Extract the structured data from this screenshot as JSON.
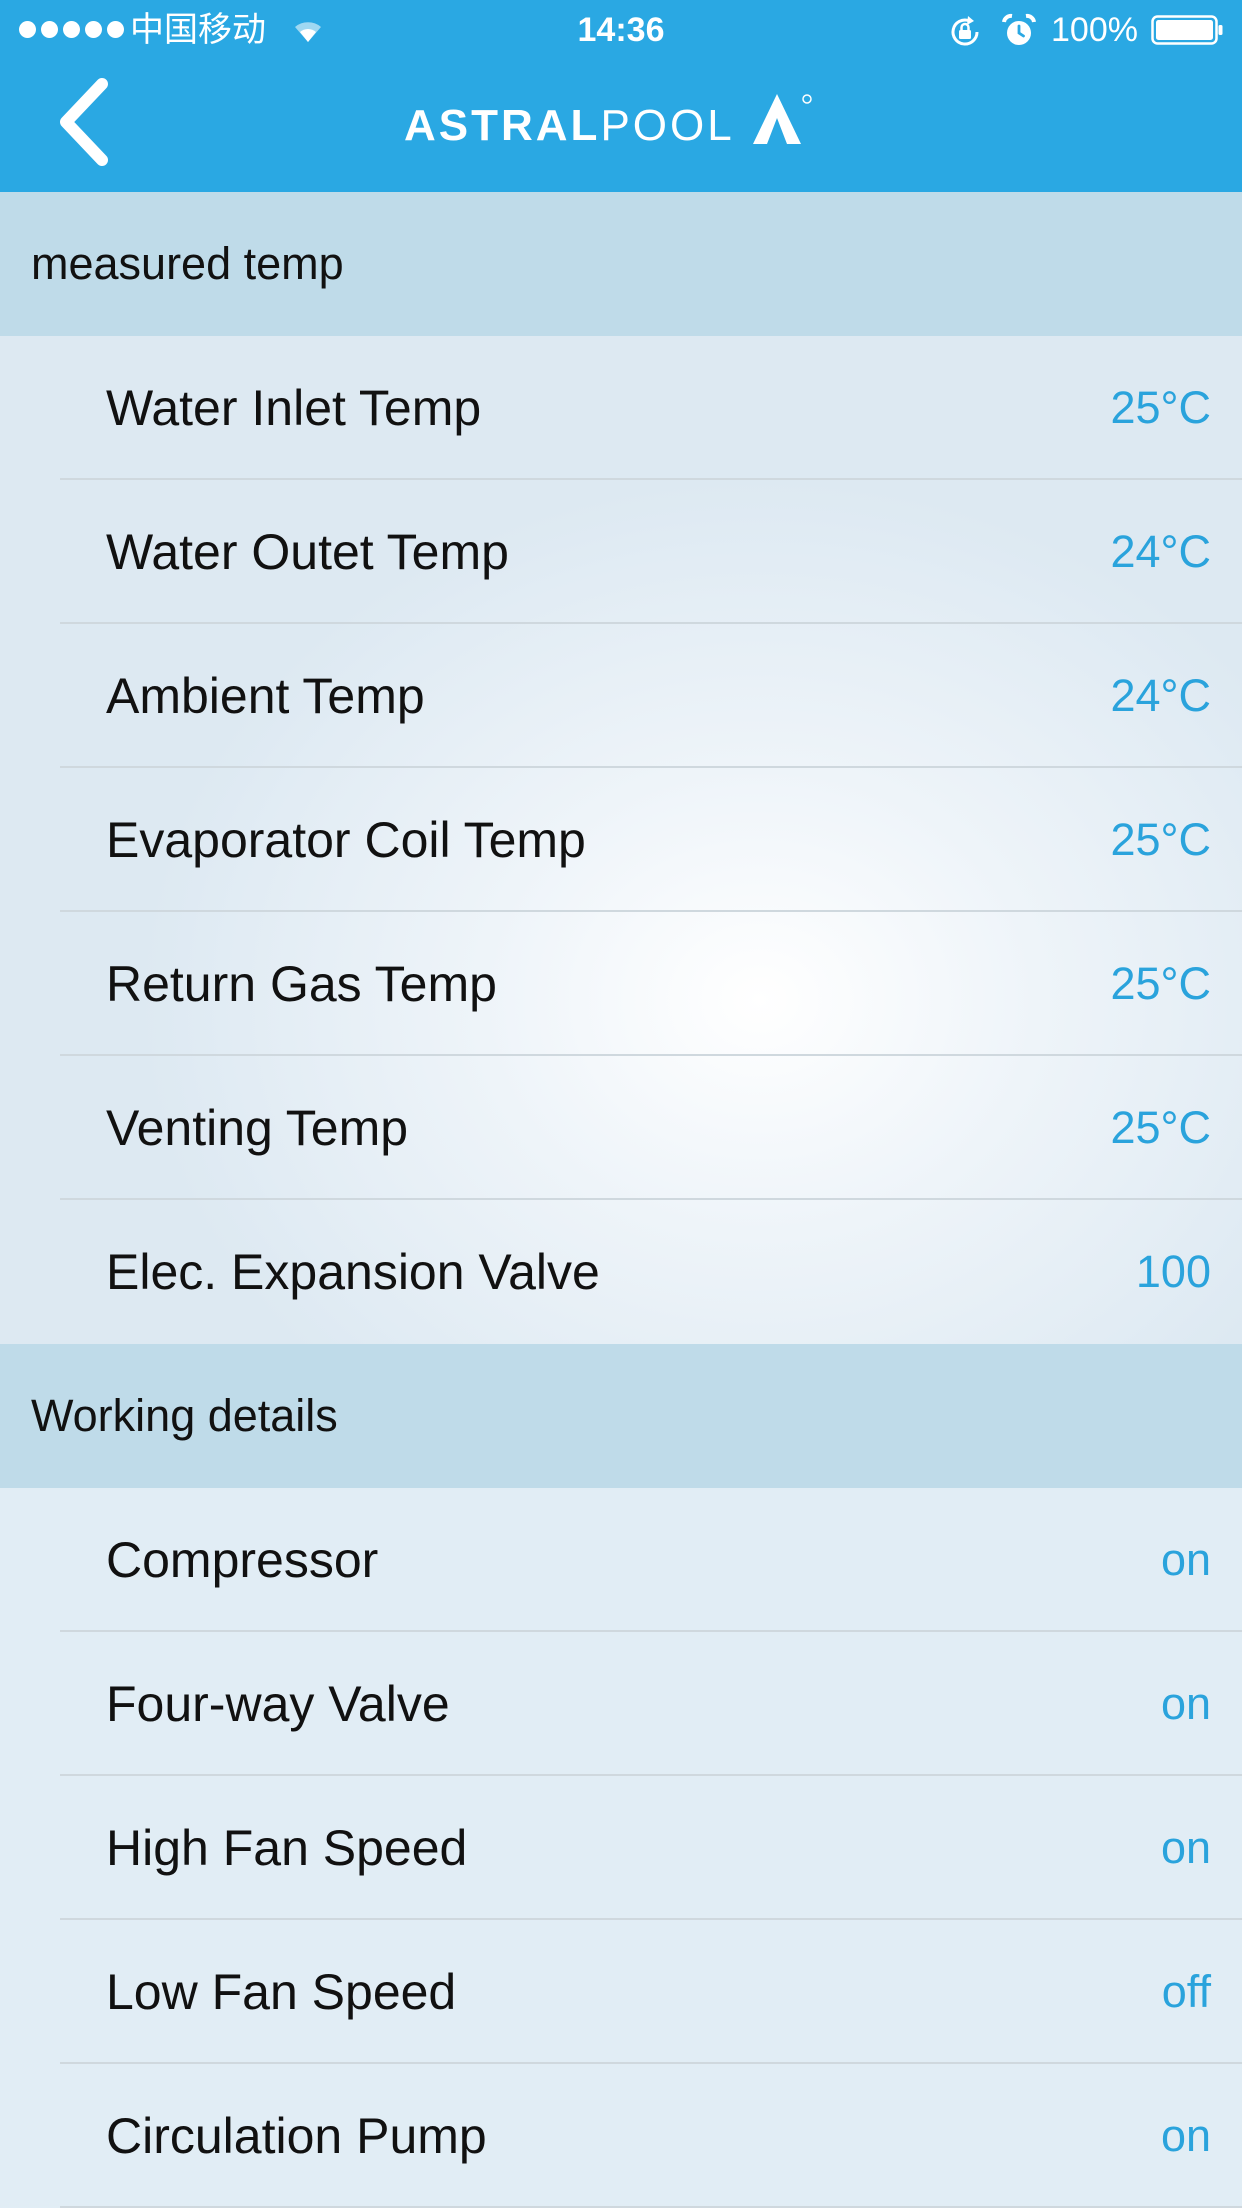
{
  "status_bar": {
    "carrier": "中国移动",
    "time": "14:36",
    "battery": "100%"
  },
  "nav": {
    "logo_bold": "ASTRAL",
    "logo_light": "POOL",
    "logo_mark": "®"
  },
  "sections": [
    {
      "title": "measured temp",
      "rows": [
        {
          "label": "Water Inlet Temp",
          "value": "25°C"
        },
        {
          "label": "Water Outet Temp",
          "value": "24°C"
        },
        {
          "label": "Ambient Temp",
          "value": "24°C"
        },
        {
          "label": "Evaporator Coil Temp",
          "value": "25°C"
        },
        {
          "label": "Return Gas Temp",
          "value": "25°C"
        },
        {
          "label": "Venting Temp",
          "value": "25°C"
        },
        {
          "label": "Elec. Expansion Valve",
          "value": "100"
        }
      ]
    },
    {
      "title": "Working details",
      "rows": [
        {
          "label": "Compressor",
          "value": "on"
        },
        {
          "label": "Four-way Valve",
          "value": "on"
        },
        {
          "label": "High Fan Speed",
          "value": "on"
        },
        {
          "label": "Low Fan Speed",
          "value": "off"
        },
        {
          "label": "Circulation Pump",
          "value": "on"
        }
      ]
    }
  ],
  "colors": {
    "header": "#2aa8e3",
    "section_header": "#bfdbe9",
    "value_text": "#2aa3dc"
  }
}
